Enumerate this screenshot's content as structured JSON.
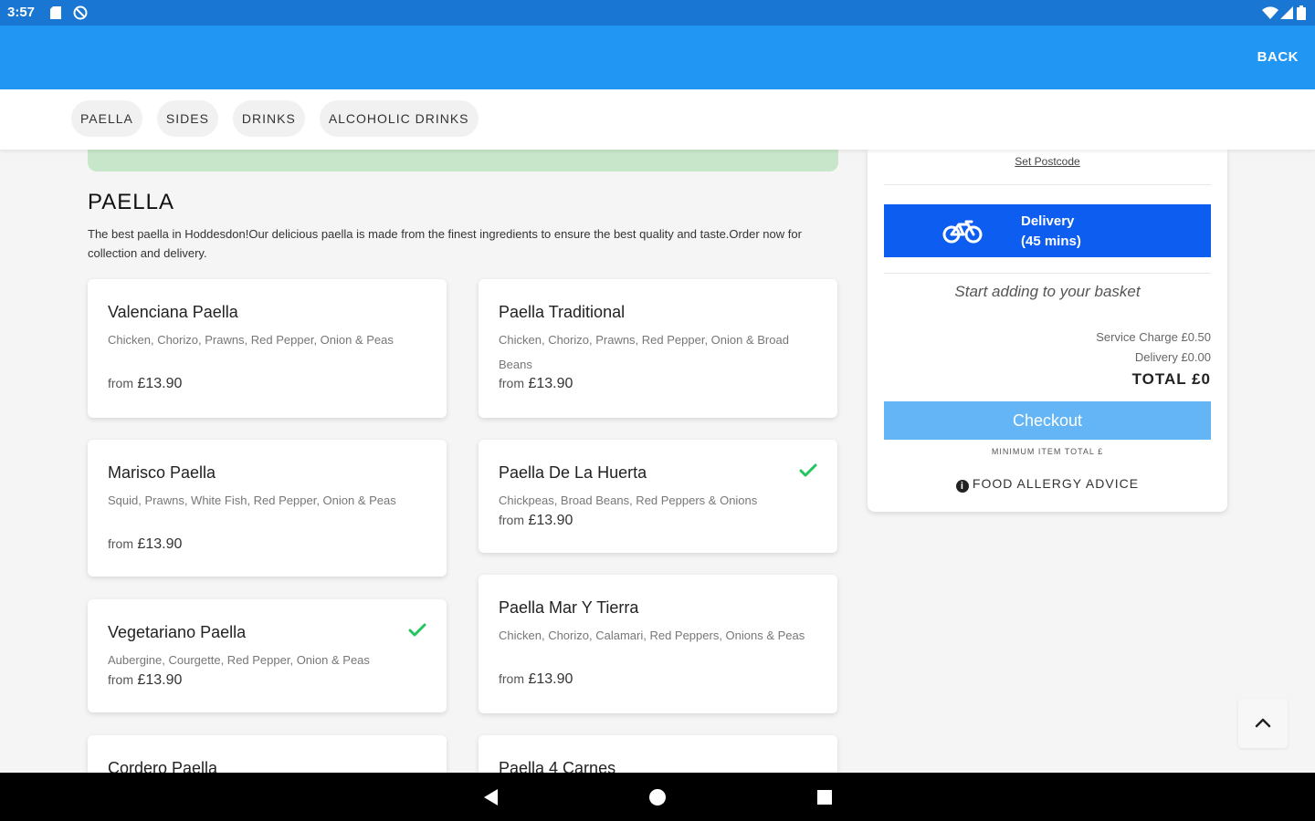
{
  "status_bar": {
    "time": "3:57"
  },
  "app_bar": {
    "back_label": "BACK"
  },
  "categories": [
    "PAELLA",
    "SIDES",
    "DRINKS",
    "ALCOHOLIC DRINKS"
  ],
  "section": {
    "title": "PAELLA",
    "description": "The best paella in Hoddesdon!Our delicious paella is made from the finest ingredients to ensure the best quality and taste.Order now for collection and delivery."
  },
  "menu_items": [
    {
      "name": "Valenciana Paella",
      "description": "Chicken, Chorizo, Prawns, Red Pepper, Onion & Peas",
      "price_prefix": "from",
      "price": "£13.90",
      "vegetarian": false
    },
    {
      "name": "Paella Traditional",
      "description": "Chicken, Chorizo, Prawns, Red Pepper, Onion & Broad Beans",
      "price_prefix": "from",
      "price": "£13.90",
      "vegetarian": false
    },
    {
      "name": "Marisco Paella",
      "description": "Squid, Prawns, White Fish, Red Pepper, Onion & Peas",
      "price_prefix": "from",
      "price": "£13.90",
      "vegetarian": false
    },
    {
      "name": "Paella De La Huerta",
      "description": "Chickpeas, Broad Beans, Red Peppers & Onions",
      "price_prefix": "from",
      "price": "£13.90",
      "vegetarian": true
    },
    {
      "name": "Vegetariano Paella",
      "description": "Aubergine, Courgette, Red Pepper, Onion & Peas",
      "price_prefix": "from",
      "price": "£13.90",
      "vegetarian": true
    },
    {
      "name": "Paella Mar Y Tierra",
      "description": "Chicken, Chorizo, Calamari, Red Peppers, Onions & Peas",
      "price_prefix": "from",
      "price": "£13.90",
      "vegetarian": false
    },
    {
      "name": "Cordero Paella"
    },
    {
      "name": "Paella 4 Carnes"
    }
  ],
  "basket": {
    "set_postcode": "Set Postcode",
    "delivery_line1": "Delivery",
    "delivery_line2": "(45 mins)",
    "empty_message": "Start adding to your basket",
    "service_charge": "Service Charge £0.50",
    "delivery_fee": "Delivery £0.00",
    "total": "TOTAL £0",
    "checkout_label": "Checkout",
    "minimum_total": "MINIMUM ITEM TOTAL £",
    "allergy_label": "FOOD ALLERGY ADVICE"
  },
  "icons": {
    "vegetarian": "leaf-check-icon",
    "delivery": "bicycle-icon",
    "scroll_top": "chevron-up-icon"
  },
  "colors": {
    "status_bar": "#1976d2",
    "app_bar": "#2196f3",
    "delivery_button": "#0d5ef0",
    "checkout_button": "#64b5f6",
    "vegetarian_check": "#22c55e",
    "banner": "#c8e6c9"
  }
}
